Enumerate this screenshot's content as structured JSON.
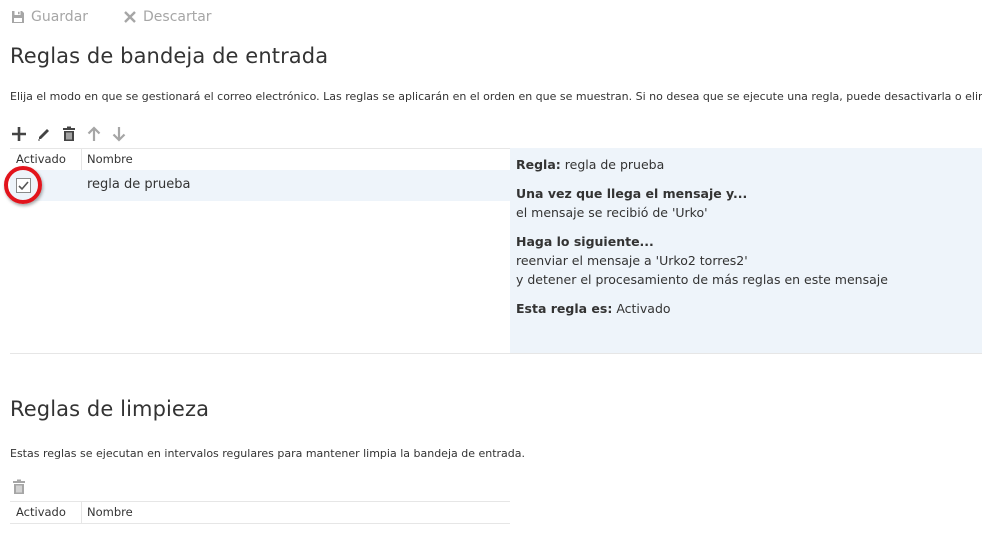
{
  "toolbar": {
    "save_label": "Guardar",
    "discard_label": "Descartar"
  },
  "inbox_rules": {
    "title": "Reglas de bandeja de entrada",
    "description": "Elija el modo en que se gestionará el correo electrónico. Las reglas se aplicarán en el orden en que se muestran. Si no desea que se ejecute una regla, puede desactivarla o eliminarla.",
    "icons": [
      "add-icon",
      "edit-icon",
      "delete-icon",
      "move-up-icon",
      "move-down-icon"
    ],
    "columns": {
      "enabled": "Activado",
      "name": "Nombre"
    },
    "rows": [
      {
        "name": "regla de prueba",
        "enabled": true
      }
    ],
    "detail": {
      "rule_label": "Regla:",
      "rule_name": "regla de prueba",
      "condition_heading": "Una vez que llega el mensaje y...",
      "condition": "el mensaje se recibió de 'Urko'",
      "action_heading": "Haga lo siguiente...",
      "action_1": "reenviar el mensaje a 'Urko2 torres2'",
      "action_2": "y detener el procesamiento de más reglas en este mensaje",
      "status_label": "Esta regla es:",
      "status_value": "Activado"
    }
  },
  "sweep_rules": {
    "title": "Reglas de limpieza",
    "description": "Estas reglas se ejecutan en intervalos regulares para mantener limpia la bandeja de entrada.",
    "icons": [
      "delete-icon"
    ],
    "columns": {
      "enabled": "Activado",
      "name": "Nombre"
    },
    "rows": []
  },
  "colors": {
    "accent": "#e2141c",
    "selection": "#eef4fa",
    "icon_dark": "#444444",
    "icon_disabled": "#a6a6a6"
  }
}
